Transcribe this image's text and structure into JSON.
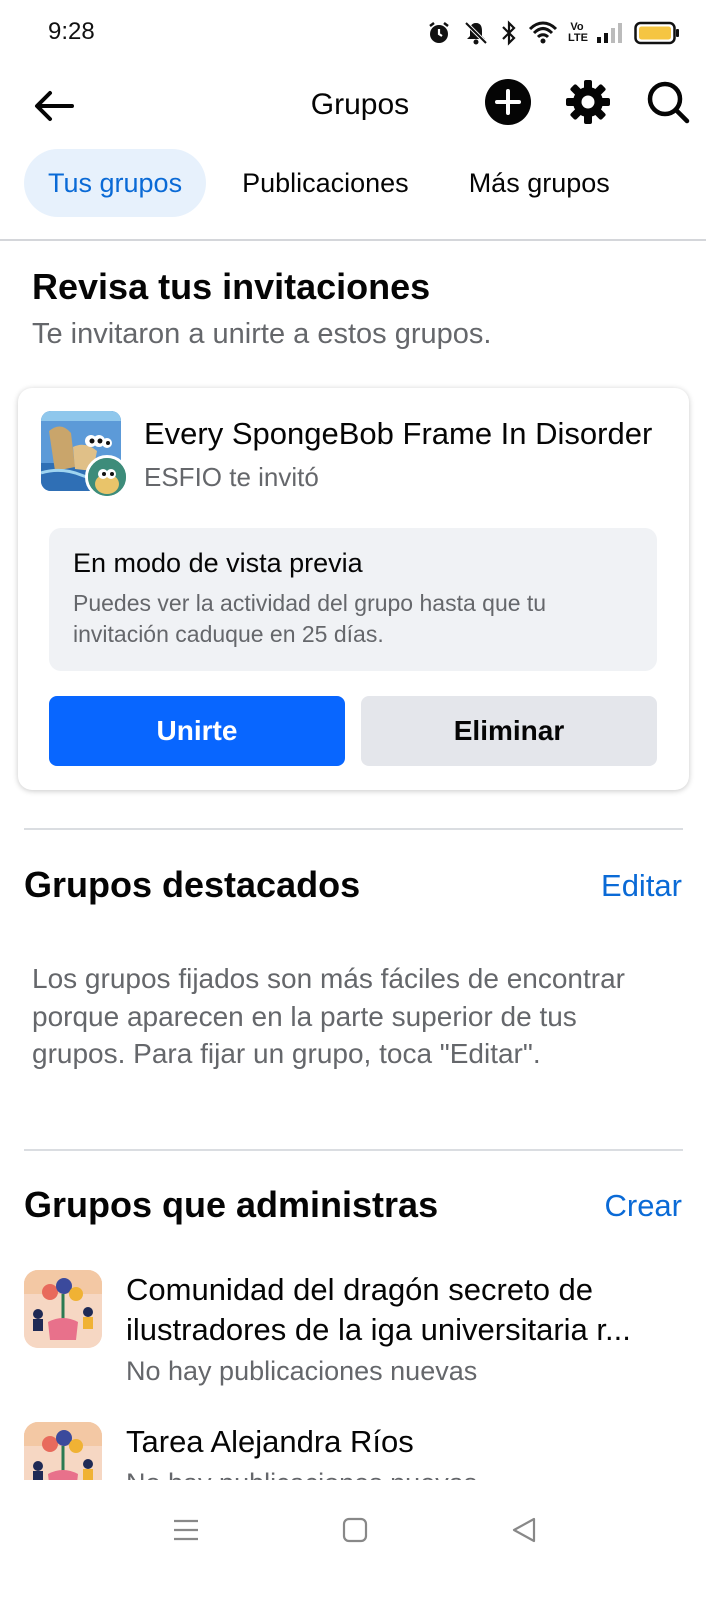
{
  "status_bar": {
    "time": "9:28",
    "icons": [
      "alarm-icon",
      "mute-icon",
      "bluetooth-icon",
      "wifi-icon",
      "volte-icon",
      "signal-icon",
      "battery-icon"
    ],
    "volte_text": "Vo LTE"
  },
  "app_bar": {
    "title": "Grupos",
    "icons": [
      "back-arrow-icon",
      "plus-icon",
      "gear-icon",
      "search-icon"
    ]
  },
  "tabs": [
    {
      "label": "Tus grupos",
      "active": true
    },
    {
      "label": "Publicaciones",
      "active": false
    },
    {
      "label": "Más grupos",
      "active": false
    }
  ],
  "invitations": {
    "heading": "Revisa tus invitaciones",
    "subheading": "Te invitaron a unirte a estos grupos.",
    "card": {
      "group_name": "Every SpongeBob Frame In Disorder",
      "inviter_text": "ESFIO te invitó",
      "preview_title": "En modo de vista previa",
      "preview_text": "Puedes ver la actividad del grupo hasta que tu invitación caduque en 25 días.",
      "join_label": "Unirte",
      "remove_label": "Eliminar"
    }
  },
  "featured": {
    "title": "Grupos destacados",
    "edit_label": "Editar",
    "description": "Los grupos fijados son más fáciles de encontrar porque aparecen en la parte superior de tus grupos. Para fijar un grupo, toca \"Editar\"."
  },
  "admin_groups": {
    "title": "Grupos que administras",
    "create_label": "Crear",
    "items": [
      {
        "name_line1": "Comunidad del dragón secreto de",
        "name_line2": "ilustradores de la iga universitaria r...",
        "meta": "No hay publicaciones nuevas"
      },
      {
        "name_line1": "Tarea Alejandra Ríos",
        "name_line2": "",
        "meta": "No hay publicaciones nuevas"
      }
    ]
  },
  "nav_bar": {
    "icons": [
      "menu-icon",
      "home-square-icon",
      "back-triangle-icon"
    ]
  },
  "colors": {
    "primary": "#0866ff",
    "link": "#0a6ad6",
    "tab_active_bg": "#e7f1fc",
    "secondary_text": "#65676b",
    "battery_fill": "#f5c542"
  }
}
